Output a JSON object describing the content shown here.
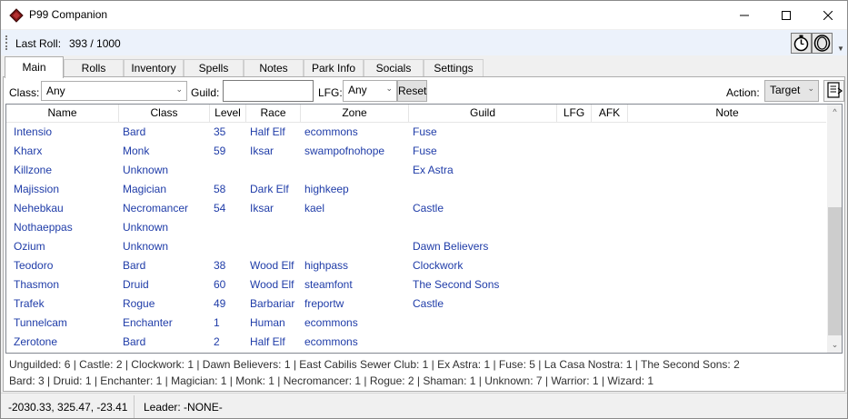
{
  "window": {
    "title": "P99 Companion"
  },
  "rollbar": {
    "label": "Last Roll:",
    "value": "393 / 1000"
  },
  "tabs": [
    {
      "label": "Main"
    },
    {
      "label": "Rolls"
    },
    {
      "label": "Inventory"
    },
    {
      "label": "Spells"
    },
    {
      "label": "Notes"
    },
    {
      "label": "Park Info"
    },
    {
      "label": "Socials"
    },
    {
      "label": "Settings"
    }
  ],
  "filters": {
    "class_label": "Class:",
    "class_value": "Any",
    "guild_label": "Guild:",
    "guild_value": "",
    "lfg_label": "LFG:",
    "lfg_value": "Any",
    "reset_label": "Reset",
    "action_label": "Action:",
    "action_value": "Target"
  },
  "grid": {
    "columns": [
      "Name",
      "Class",
      "Level",
      "Race",
      "Zone",
      "Guild",
      "LFG",
      "AFK",
      "Note"
    ],
    "rows": [
      [
        "Intensio",
        "Bard",
        "35",
        "Half Elf",
        "ecommons",
        "Fuse",
        "",
        "",
        ""
      ],
      [
        "Kharx",
        "Monk",
        "59",
        "Iksar",
        "swampofnohope",
        "Fuse",
        "",
        "",
        ""
      ],
      [
        "Killzone",
        "Unknown",
        "",
        "",
        "",
        "Ex Astra",
        "",
        "",
        ""
      ],
      [
        "Majission",
        "Magician",
        "58",
        "Dark Elf",
        "highkeep",
        "",
        "",
        "",
        ""
      ],
      [
        "Nehebkau",
        "Necromancer",
        "54",
        "Iksar",
        "kael",
        "Castle",
        "",
        "",
        ""
      ],
      [
        "Nothaeppas",
        "Unknown",
        "",
        "",
        "",
        "",
        "",
        "",
        ""
      ],
      [
        "Ozium",
        "Unknown",
        "",
        "",
        "",
        "Dawn Believers",
        "",
        "",
        ""
      ],
      [
        "Teodoro",
        "Bard",
        "38",
        "Wood Elf",
        "highpass",
        "Clockwork",
        "",
        "",
        ""
      ],
      [
        "Thasmon",
        "Druid",
        "60",
        "Wood Elf",
        "steamfont",
        "The Second Sons",
        "",
        "",
        ""
      ],
      [
        "Trafek",
        "Rogue",
        "49",
        "Barbariar",
        "freportw",
        "Castle",
        "",
        "",
        ""
      ],
      [
        "Tunnelcam",
        "Enchanter",
        "1",
        "Human",
        "ecommons",
        "",
        "",
        "",
        ""
      ],
      [
        "Zerotone",
        "Bard",
        "2",
        "Half Elf",
        "ecommons",
        "",
        "",
        "",
        ""
      ]
    ]
  },
  "summary": {
    "guilds": "Unguilded: 6 | Castle: 2 | Clockwork: 1 | Dawn Believers: 1 | East Cabilis Sewer Club: 1 | Ex Astra: 1 | Fuse: 5 | La Casa Nostra: 1 | The Second Sons: 2",
    "classes": "Bard: 3 | Druid: 1 | Enchanter: 1 | Magician: 1 | Monk: 1 | Necromancer: 1 | Rogue: 2 | Shaman: 1 | Unknown: 7 | Warrior: 1 | Wizard: 1"
  },
  "status": {
    "coords": "-2030.33, 325.47, -23.41",
    "leader": "Leader: -NONE-"
  },
  "colors": {
    "cell_text": "#1f3ca8",
    "rollbar_bg": "#ecf2fb",
    "app_icon": "#7a1414"
  },
  "icons": [
    "app-book-icon",
    "minimize-icon",
    "maximize-icon",
    "close-icon",
    "stopwatch-icon",
    "loop-icon",
    "export-document-icon"
  ]
}
